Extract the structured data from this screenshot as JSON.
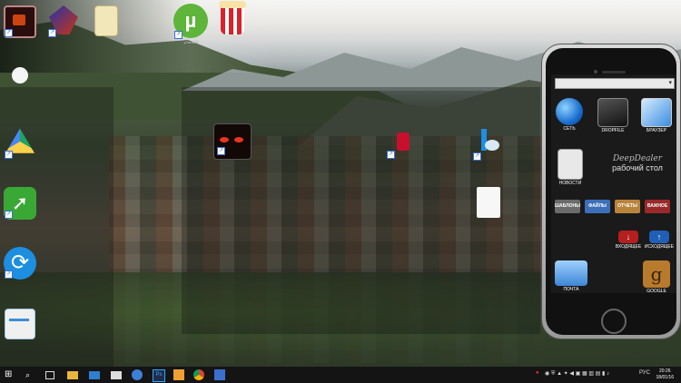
{
  "desktop": {
    "icons": [
      {
        "name": "app-icon-1",
        "label": "",
        "icon": "dark-box-red-icon"
      },
      {
        "name": "app-icon-2",
        "label": "",
        "icon": "winamp-icon"
      },
      {
        "name": "app-icon-3",
        "label": "",
        "icon": "notepad-icon"
      },
      {
        "name": "utorrent",
        "label": "µTorrent",
        "icon": "utorrent-icon"
      },
      {
        "name": "popcorn",
        "label": "",
        "icon": "popcorn-icon"
      },
      {
        "name": "white-app",
        "label": "",
        "icon": "white-blob-icon"
      },
      {
        "name": "google-drive",
        "label": "",
        "icon": "google-drive-icon"
      },
      {
        "name": "green-app",
        "label": "",
        "icon": "green-arrow-icon"
      },
      {
        "name": "sync-app",
        "label": "",
        "icon": "sync-icon"
      },
      {
        "name": "box-app",
        "label": "",
        "icon": "white-box-icon"
      },
      {
        "name": "red-eyes-app",
        "label": "",
        "icon": "red-eyes-icon"
      },
      {
        "name": "red-d-app",
        "label": "",
        "icon": "red-d-icon"
      },
      {
        "name": "bing-app",
        "label": "",
        "icon": "bing-icon"
      },
      {
        "name": "document",
        "label": "",
        "icon": "document-icon"
      }
    ]
  },
  "phone": {
    "select_value": "",
    "brand_line1": "DeepDealer",
    "brand_line2": "рабочий стол",
    "apps": {
      "network": "СЕТЬ",
      "dropfile": "DROPFILE",
      "browser": "БРАУЗЕР",
      "news": "НОВОСТИ",
      "mail": "ПОЧТА",
      "google": "GOOGLE"
    },
    "folders": {
      "templates": "ШАБЛОНЫ",
      "files": "ФАЙЛЫ",
      "reports": "ОТЧЕТЫ",
      "important": "ВАЖНОЕ",
      "incoming": "ВХОДЯЩЕЕ",
      "outgoing": "ИСХОДЯЩЕЕ"
    }
  },
  "taskbar": {
    "language": "РУС",
    "time": "20:26",
    "date": "18/01/16",
    "colors": {
      "background": "#141414"
    }
  }
}
